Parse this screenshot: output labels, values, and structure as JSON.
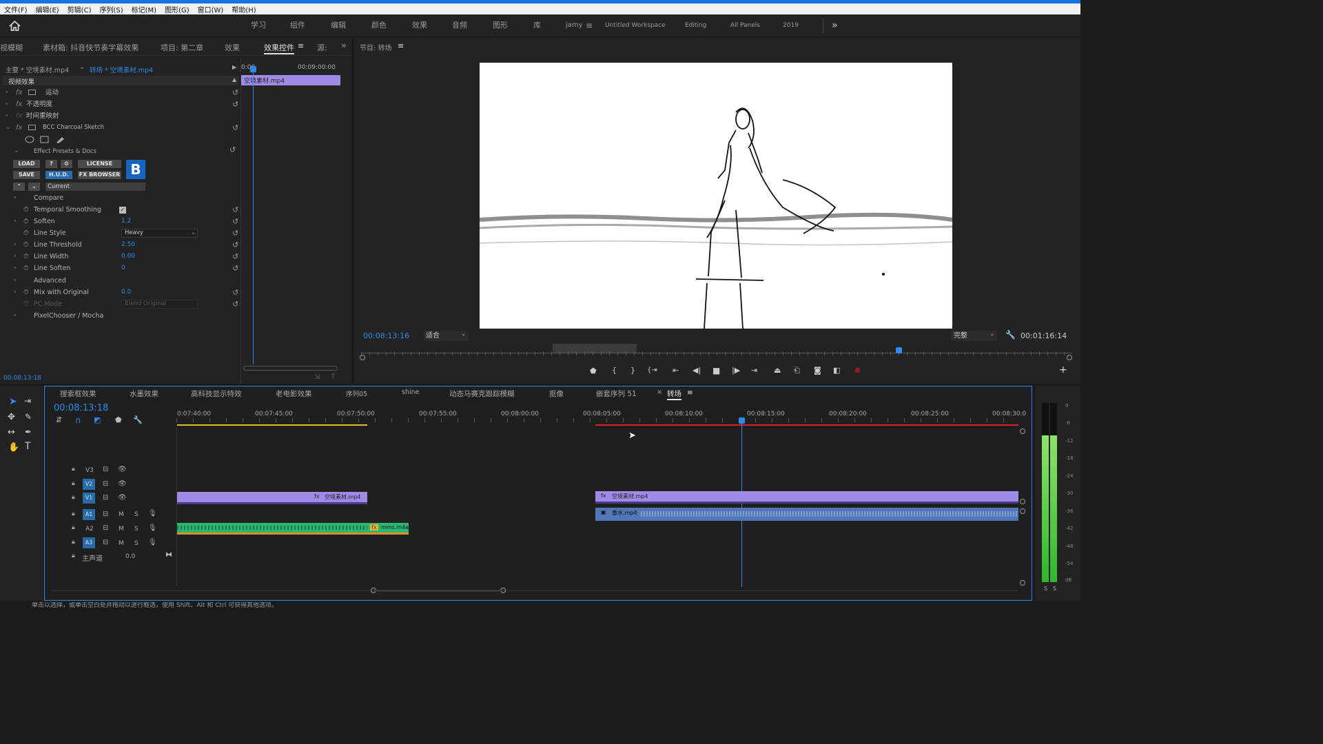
{
  "menubar": [
    "文件(F)",
    "编辑(E)",
    "剪辑(C)",
    "序列(S)",
    "标记(M)",
    "图形(G)",
    "窗口(W)",
    "帮助(H)"
  ],
  "workspace": {
    "tabs": [
      "学习",
      "组件",
      "编辑",
      "颜色",
      "效果",
      "音频",
      "图形",
      "库"
    ],
    "active": "jamy",
    "others": [
      "Untitled Workspace",
      "Editing",
      "All Panels",
      "2019"
    ],
    "more": "»"
  },
  "left_tabs": [
    "视模糊",
    "素材箱: 抖音快节奏字幕效果",
    "项目: 第二章",
    "效果",
    "效果控件",
    "源:"
  ],
  "left_tabs_more": "»",
  "effect_controls": {
    "source": "主要 * 空境素材.mp4",
    "sequence_clip": "转场 * 空境素材.mp4",
    "time_start": "0:00",
    "time_end": "00:09:00:00",
    "clip_name": "空境素材.mp4",
    "section": "视频效果",
    "effects": [
      "运动",
      "不透明度",
      "时间重映射",
      "BCC Charcoal Sketch"
    ],
    "presets_label": "Effect Presets & Docs",
    "buttons": {
      "load": "LOAD",
      "help": "?",
      "license": "LICENSE",
      "save": "SAVE",
      "hud": "H.U.D.",
      "fxbrowser": "FX BROWSER",
      "current": "Current",
      "logo": "B"
    },
    "params": [
      {
        "name": "Compare",
        "value": ""
      },
      {
        "name": "Temporal Smoothing",
        "value": ""
      },
      {
        "name": "Soften",
        "value": "1.2"
      },
      {
        "name": "Line Style",
        "value": "Heavy"
      },
      {
        "name": "Line Threshold",
        "value": "2.50"
      },
      {
        "name": "Line Width",
        "value": "0.00"
      },
      {
        "name": "Line Soften",
        "value": "0"
      },
      {
        "name": "Advanced",
        "value": ""
      },
      {
        "name": "Mix with Original",
        "value": "0.0"
      },
      {
        "name": "PC Mode",
        "value": "Blend Original"
      },
      {
        "name": "PixelChooser / Mocha",
        "value": ""
      }
    ],
    "timecode": "00:08:13:18"
  },
  "program": {
    "title": "节目: 转场",
    "timecode": "00:08:13:16",
    "fit": "适合",
    "quality": "完整",
    "duration": "00:01:16:14"
  },
  "timeline": {
    "tabs": [
      "搜索框效果",
      "水墨效果",
      "高科技显示特效",
      "老电影效果",
      "序列05",
      "shine",
      "动态马赛克跟踪模糊",
      "抠像",
      "嵌套序列 51",
      "转场"
    ],
    "active_tab": "转场",
    "timecode": "00:08:13:18",
    "ruler": [
      "0:07:40:00",
      "00:07:45:00",
      "00:07:50:00",
      "00:07:55:00",
      "00:08:00:00",
      "00:08:05:00",
      "00:08:10:00",
      "00:08:15:00",
      "00:08:20:00",
      "00:08:25:00",
      "00:08:30:0"
    ],
    "tracks": {
      "v3": "V3",
      "v2": "V2",
      "v1": "V1",
      "a1": "A1",
      "a2": "A2",
      "a3": "A3",
      "master": "主声道",
      "master_val": "0.0",
      "m": "M",
      "s": "S"
    },
    "clips": {
      "v1a": "空境素材.mp4",
      "v1b": "空境素材.mp4",
      "a1": "香水.mp4",
      "a2": "mms.m4a"
    }
  },
  "meter": {
    "labels": [
      "0",
      "-6",
      "-12",
      "-18",
      "-24",
      "-30",
      "-36",
      "-42",
      "-48",
      "-54",
      "dB"
    ],
    "solo": "S"
  },
  "status": "单击以选择，或单击空白处并拖动以进行框选，使用 Shift、Alt 和 Ctrl 可获得其他选项。"
}
